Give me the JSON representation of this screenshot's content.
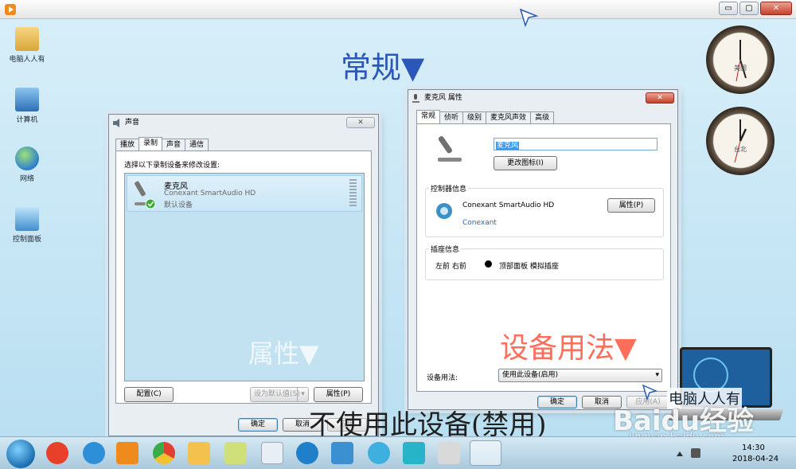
{
  "player": {
    "controls": [
      "▭",
      "▢",
      "✕"
    ]
  },
  "desktop_icons": [
    {
      "label": "电脑人人有",
      "color": "#e2b850"
    },
    {
      "label": "计算机",
      "color": "#4a8fcf"
    },
    {
      "label": "网络",
      "color": "#3a8fd8"
    },
    {
      "label": "控制面板",
      "color": "#5aa6d8"
    }
  ],
  "overlays": {
    "top_heading": "常规▼",
    "props_heading": "属性▼",
    "usage_heading": "设备用法▼",
    "disable_caption": "不使用此设备(禁用)"
  },
  "clocks": [
    {
      "city": "美国"
    },
    {
      "city": "台北"
    }
  ],
  "sound_dialog": {
    "title": "声音",
    "close_label": "✕",
    "tabs": [
      "播放",
      "录制",
      "声音",
      "通信"
    ],
    "active_tab": 1,
    "instruction": "选择以下录制设备来修改设置:",
    "device": {
      "name": "麦克风",
      "driver": "Conexant SmartAudio HD",
      "status": "默认设备"
    },
    "configure_button": "配置(C)",
    "set_default_button": "设为默认值(S)",
    "set_default_arrow": "▾",
    "properties_button": "属性(P)",
    "ok_button": "确定",
    "cancel_button": "取消",
    "apply_button": "应用"
  },
  "mic_props": {
    "title": "麦克风 属性",
    "close_label": "✕",
    "tabs": [
      "常规",
      "侦听",
      "级别",
      "麦克风声效",
      "高级"
    ],
    "active_tab": 0,
    "name_value": "麦克风",
    "change_icon_button": "更改图标(I)",
    "controller_group": "控制器信息",
    "controller_name": "Conexant SmartAudio HD",
    "controller_vendor": "Conexant",
    "controller_props_button": "属性(P)",
    "jack_group": "插座信息",
    "jack_position": "左前 右前",
    "jack_desc": "顶部面板 模拟插座",
    "usage_label": "设备用法:",
    "usage_value": "使用此设备(启用)",
    "usage_arrow": "▾",
    "ok_button": "确定",
    "cancel_button": "取消",
    "apply_button": "应用(A)"
  },
  "taskbar": {
    "apps": [
      {
        "name": "start",
        "color": "#1b6fb0"
      },
      {
        "name": "app-jiang",
        "color": "#e8402a"
      },
      {
        "name": "ie",
        "color": "#2d8fd8"
      },
      {
        "name": "media-player",
        "color": "#f08a1c"
      },
      {
        "name": "chrome",
        "color": "#3bab4a"
      },
      {
        "name": "explorer",
        "color": "#f2c14e"
      },
      {
        "name": "notes",
        "color": "#cfe07a"
      },
      {
        "name": "document",
        "color": "#e8eef5"
      },
      {
        "name": "browser",
        "color": "#1f7fc9"
      },
      {
        "name": "control-panel",
        "color": "#3a90d0"
      },
      {
        "name": "pinwheel",
        "color": "#3db0e0"
      },
      {
        "name": "headset",
        "color": "#28b4c8"
      },
      {
        "name": "paint",
        "color": "#d9d9d9"
      },
      {
        "name": "sound",
        "color": "#c6c6c6"
      }
    ],
    "time": "14:30",
    "date": "2018-04-24"
  },
  "watermark": {
    "brand": "Baidu经验",
    "url": "jingyan.baidu.com",
    "laptop_text": "电脑人人有"
  }
}
